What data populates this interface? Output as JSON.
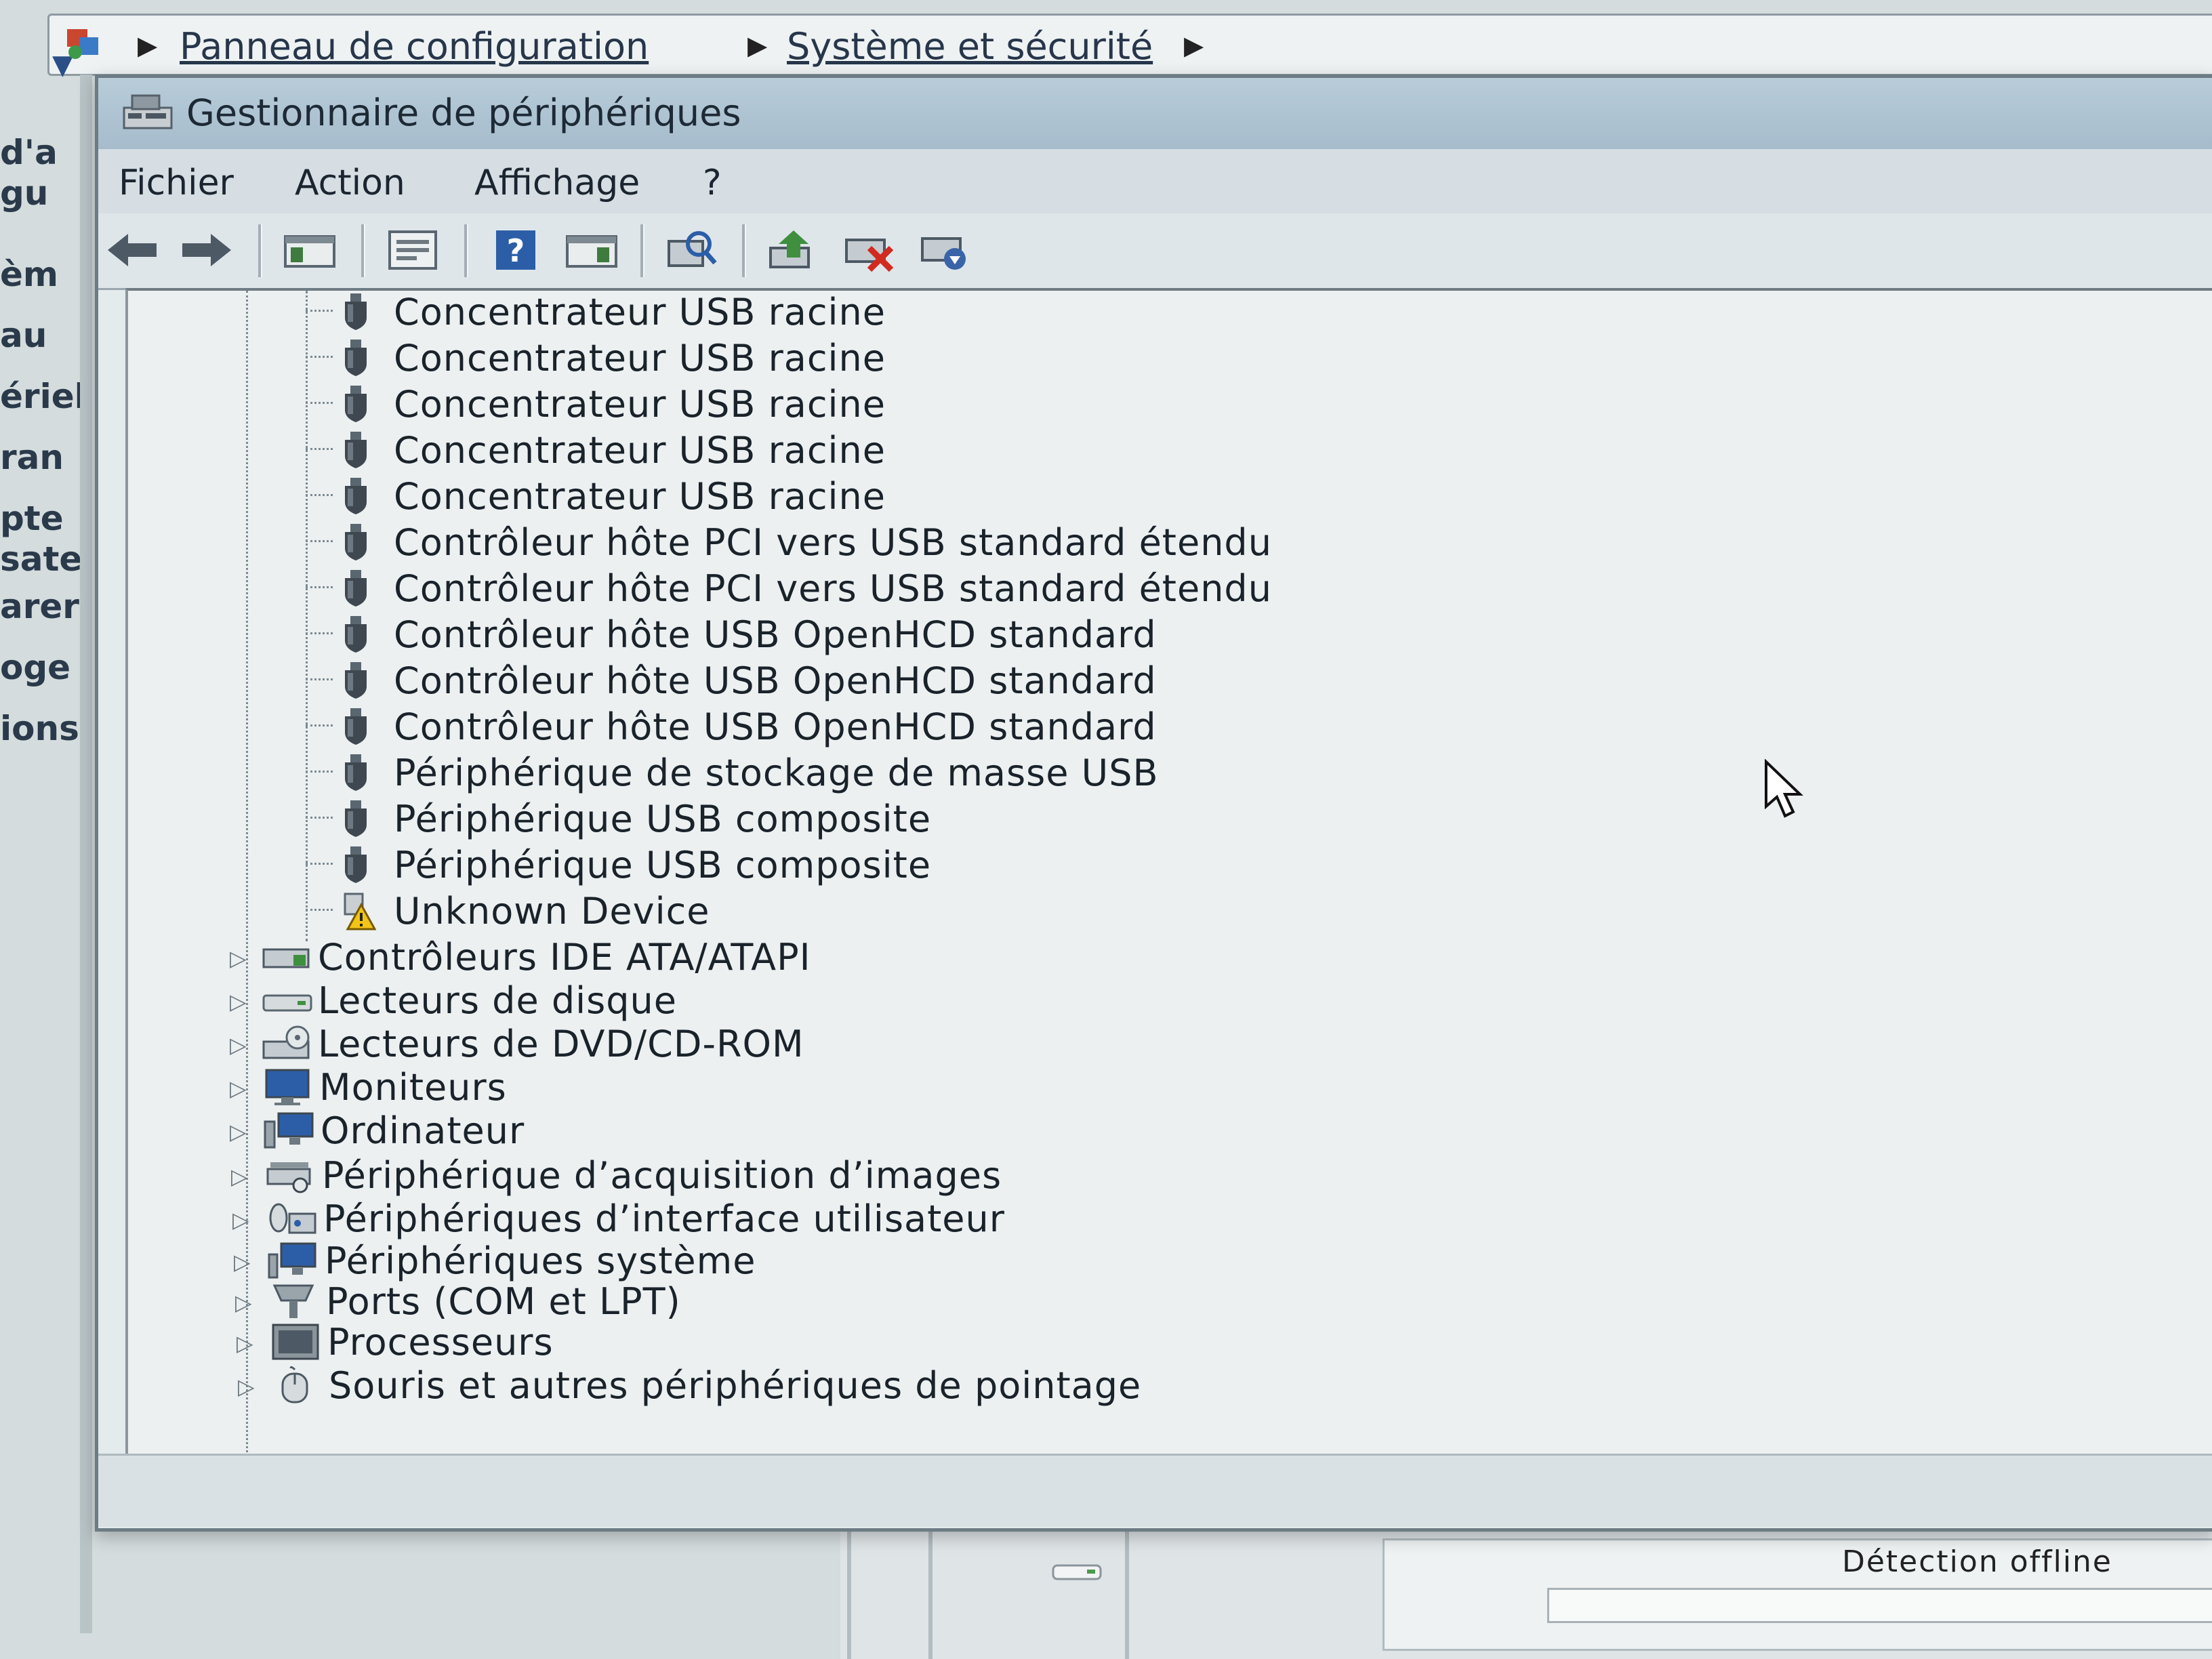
{
  "address_bar": {
    "crumbs": [
      "Panneau de configuration",
      "Système et sécurité"
    ]
  },
  "left_pane_fragments": [
    "d'a",
    "gu",
    "èm",
    "au",
    "ériel",
    "ran",
    "pte",
    "sate",
    "arer",
    "oge",
    "ions"
  ],
  "window": {
    "title": "Gestionnaire de périphériques",
    "menu": [
      "Fichier",
      "Action",
      "Affichage",
      "?"
    ]
  },
  "toolbar": {
    "buttons": [
      {
        "icon": "back-arrow-icon"
      },
      {
        "icon": "forward-arrow-icon"
      },
      {
        "icon": "show-hide-console-tree-icon"
      },
      {
        "icon": "properties-icon"
      },
      {
        "icon": "help-icon"
      },
      {
        "icon": "show-hide-action-pane-icon"
      },
      {
        "icon": "scan-hardware-changes-icon"
      },
      {
        "icon": "update-driver-icon"
      },
      {
        "icon": "uninstall-device-icon"
      },
      {
        "icon": "disable-device-icon"
      }
    ]
  },
  "usb_children": [
    {
      "label": "Concentrateur USB racine",
      "icon": "usb-plug-icon"
    },
    {
      "label": "Concentrateur USB racine",
      "icon": "usb-plug-icon"
    },
    {
      "label": "Concentrateur USB racine",
      "icon": "usb-plug-icon"
    },
    {
      "label": "Concentrateur USB racine",
      "icon": "usb-plug-icon"
    },
    {
      "label": "Concentrateur USB racine",
      "icon": "usb-plug-icon"
    },
    {
      "label": "Contrôleur hôte PCI vers USB standard étendu",
      "icon": "usb-plug-icon"
    },
    {
      "label": "Contrôleur hôte PCI vers USB standard étendu",
      "icon": "usb-plug-icon"
    },
    {
      "label": "Contrôleur hôte USB OpenHCD standard",
      "icon": "usb-plug-icon"
    },
    {
      "label": "Contrôleur hôte USB OpenHCD standard",
      "icon": "usb-plug-icon"
    },
    {
      "label": "Contrôleur hôte USB OpenHCD standard",
      "icon": "usb-plug-icon"
    },
    {
      "label": "Périphérique de stockage de masse USB",
      "icon": "usb-plug-icon"
    },
    {
      "label": "Périphérique USB composite",
      "icon": "usb-plug-icon"
    },
    {
      "label": "Périphérique USB composite",
      "icon": "usb-plug-icon"
    },
    {
      "label": "Unknown Device",
      "icon": "warning-device-icon"
    }
  ],
  "categories": [
    {
      "label": "Contrôleurs IDE ATA/ATAPI",
      "icon": "ide-controller-icon"
    },
    {
      "label": "Lecteurs de disque",
      "icon": "disk-drive-icon"
    },
    {
      "label": "Lecteurs de DVD/CD-ROM",
      "icon": "dvd-drive-icon"
    },
    {
      "label": "Moniteurs",
      "icon": "monitor-icon"
    },
    {
      "label": "Ordinateur",
      "icon": "computer-icon"
    },
    {
      "label": "Périphérique d’acquisition d’images",
      "icon": "imaging-device-icon"
    },
    {
      "label": "Périphériques d’interface utilisateur",
      "icon": "hid-icon"
    },
    {
      "label": "Périphériques système",
      "icon": "system-devices-icon"
    },
    {
      "label": "Ports (COM et LPT)",
      "icon": "ports-icon"
    },
    {
      "label": "Processeurs",
      "icon": "processor-icon"
    },
    {
      "label": "Souris et autres périphériques de pointage",
      "icon": "mouse-icon"
    }
  ],
  "status": {
    "detection_label": "Détection offline"
  },
  "colors": {
    "titlebar": "#a6bccc",
    "tree_background": "#ecf0f1",
    "icon_blue": "#2c5ea8",
    "warning_yellow": "#f2c418"
  }
}
